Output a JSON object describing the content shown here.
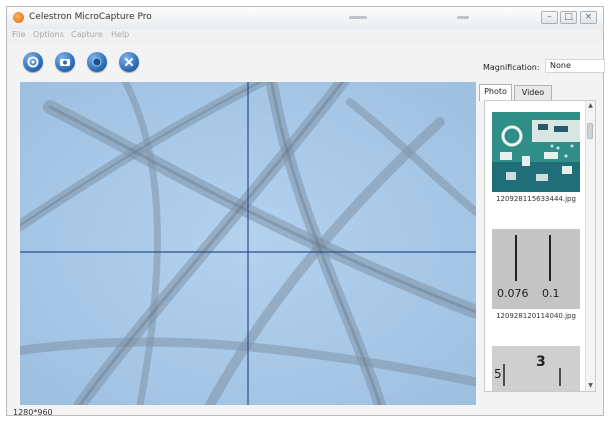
{
  "window": {
    "title": "Celestron MicroCapture Pro"
  },
  "menu": [
    "File",
    "Options",
    "Capture",
    "Help"
  ],
  "toolbar": {
    "magnification_label": "Magnification:",
    "magnification_value": "None"
  },
  "tabs": [
    {
      "label": "Photo",
      "active": true
    },
    {
      "label": "Video",
      "active": false
    }
  ],
  "thumbnails": [
    {
      "caption": "120928115633444.jpg"
    },
    {
      "caption": "120928120114040.jpg",
      "ruler_labels": [
        "0.076",
        "0.1"
      ]
    },
    {
      "ruler_labels": [
        "3",
        "5"
      ]
    }
  ],
  "status": {
    "resolution": "1280*960"
  },
  "icons": [
    "settings-icon",
    "camera-icon",
    "record-icon",
    "close-icon"
  ],
  "colors": {
    "viewer_bg": "#a8c8e6",
    "crosshair": "#2a4f8f",
    "tool_button": "#2a69b5"
  }
}
